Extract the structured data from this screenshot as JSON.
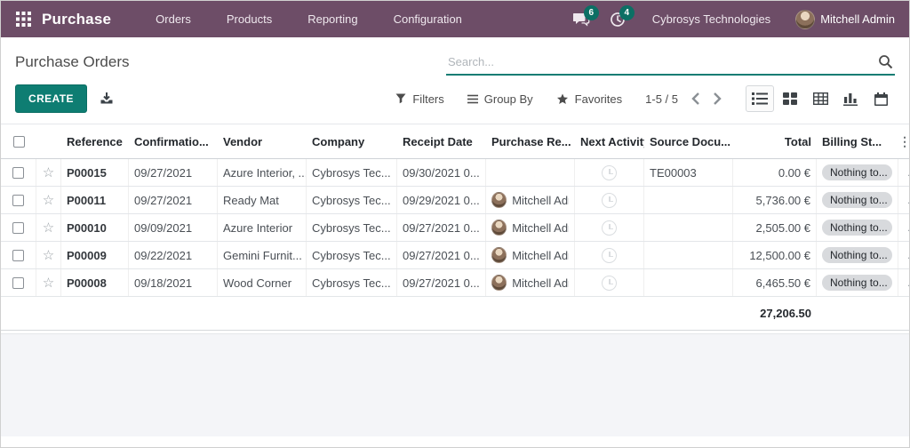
{
  "navbar": {
    "app_name": "Purchase",
    "menus": {
      "orders": "Orders",
      "products": "Products",
      "reporting": "Reporting",
      "configuration": "Configuration"
    },
    "messages_count": "6",
    "activities_count": "4",
    "company": "Cybrosys Technologies",
    "user": "Mitchell Admin"
  },
  "control_panel": {
    "title": "Purchase Orders",
    "search_placeholder": "Search...",
    "create_label": "CREATE",
    "filters_label": "Filters",
    "group_by_label": "Group By",
    "favorites_label": "Favorites",
    "pager": "1-5 / 5"
  },
  "table": {
    "headers": {
      "reference": "Reference",
      "confirmation": "Confirmatio...",
      "vendor": "Vendor",
      "company": "Company",
      "receipt": "Receipt Date",
      "purchase_rep": "Purchase Re...",
      "next_activity": "Next Activity",
      "source": "Source Docu...",
      "total": "Total",
      "billing": "Billing St..."
    },
    "rows": [
      {
        "reference": "P00015",
        "confirmation": "09/27/2021",
        "vendor": "Azure Interior, ...",
        "company": "Cybrosys Tec...",
        "receipt": "09/30/2021 0...",
        "rep": "",
        "source": "TE00003",
        "total": "0.00 €",
        "billing": "Nothing to...",
        "more": "..."
      },
      {
        "reference": "P00011",
        "confirmation": "09/27/2021",
        "vendor": "Ready Mat",
        "company": "Cybrosys Tec...",
        "receipt": "09/29/2021 0...",
        "rep": "Mitchell Adr",
        "source": "",
        "total": "5,736.00 €",
        "billing": "Nothing to...",
        "more": "..."
      },
      {
        "reference": "P00010",
        "confirmation": "09/09/2021",
        "vendor": "Azure Interior",
        "company": "Cybrosys Tec...",
        "receipt": "09/27/2021 0...",
        "rep": "Mitchell Adr",
        "source": "",
        "total": "2,505.00 €",
        "billing": "Nothing to...",
        "more": "..."
      },
      {
        "reference": "P00009",
        "confirmation": "09/22/2021",
        "vendor": "Gemini Furnit...",
        "company": "Cybrosys Tec...",
        "receipt": "09/27/2021 0...",
        "rep": "Mitchell Adr",
        "source": "",
        "total": "12,500.00 €",
        "billing": "Nothing to...",
        "more": "..."
      },
      {
        "reference": "P00008",
        "confirmation": "09/18/2021",
        "vendor": "Wood Corner",
        "company": "Cybrosys Tec...",
        "receipt": "09/27/2021 0...",
        "rep": "Mitchell Adr",
        "source": "",
        "total": "6,465.50 €",
        "billing": "Nothing to...",
        "more": "..."
      }
    ],
    "footer_total": "27,206.50"
  },
  "colors": {
    "navbar_bg": "#6d4d67",
    "accent_teal": "#0e7d72",
    "badge_teal": "#0c6f64",
    "pill_grey": "#d8dadd"
  }
}
